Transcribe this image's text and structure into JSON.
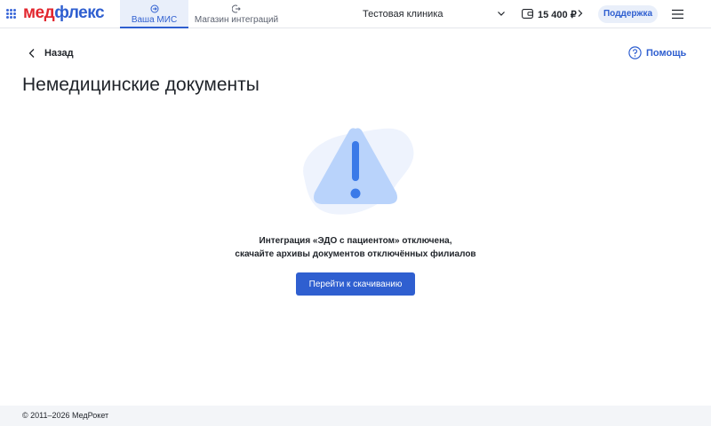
{
  "header": {
    "logo": {
      "part1": "мед",
      "part2": "флекс"
    },
    "tabs": [
      {
        "label": "Ваша МИС",
        "icon": "login-icon",
        "active": true
      },
      {
        "label": "Магазин интеграций",
        "icon": "logout-icon",
        "active": false
      }
    ],
    "clinic": "Тестовая клиника",
    "balance": "15 400 ₽",
    "support": "Поддержка"
  },
  "nav": {
    "back": "Назад",
    "help": "Помощь"
  },
  "page": {
    "title": "Немедицинские документы",
    "message_line1": "Интеграция «ЭДО с пациентом» отключена,",
    "message_line2": "скачайте архивы документов отключённых филиалов",
    "cta": "Перейти к скачиванию"
  },
  "footer": {
    "copyright": "© 2011–2026 МедРокет"
  },
  "colors": {
    "brand_red": "#e2262e",
    "brand_blue": "#2f5fd0",
    "warning_fill": "#b9d3fb",
    "warning_mark": "#3b7ae8"
  }
}
